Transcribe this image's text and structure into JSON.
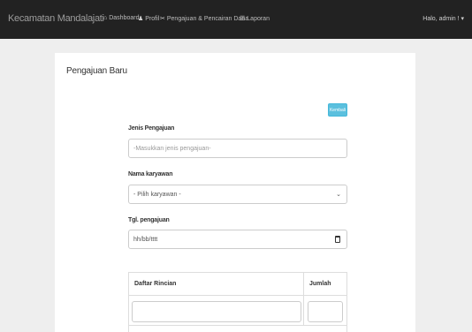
{
  "navbar": {
    "brand": "Kecamatan Mandalajati",
    "items": [
      {
        "icon": "home-icon",
        "glyph": "⌂",
        "label": "Dashboard"
      },
      {
        "icon": "user-icon",
        "glyph": "♟",
        "label": "Profil"
      },
      {
        "icon": "tools-icon",
        "glyph": "✂",
        "label": "Pengajuan & Pencairan Dana"
      },
      {
        "icon": "list-icon",
        "glyph": "☰",
        "label": "Laporan"
      }
    ],
    "user_menu": "Halo, admin ! ▾"
  },
  "panel": {
    "title": "Pengajuan Baru",
    "back_button": "Kembali"
  },
  "form": {
    "jenis_label": "Jenis Pengajuan",
    "jenis_placeholder": "-Masukkan jenis pengajuan-",
    "karyawan_label": "Nama karyawan",
    "karyawan_value": "- Pilih karyawan -",
    "tgl_label": "Tgl. pengajuan",
    "tgl_value": "hh/bb/tttt"
  },
  "table": {
    "col_daftar": "Daftar Rincian",
    "col_jumlah": "Jumlah"
  }
}
